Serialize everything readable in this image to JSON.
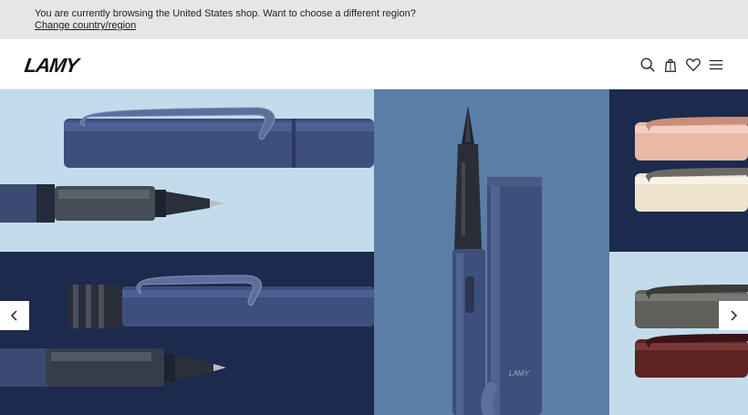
{
  "region_banner": {
    "message": "You are currently browsing the United States shop. Want to choose a different region?",
    "link": "Change country/region"
  },
  "header": {
    "logo": "LAMY",
    "icons": [
      "search-icon",
      "shopping-bag-icon",
      "heart-icon",
      "menu-icon"
    ]
  },
  "hero": {
    "controls": [
      "chevron-left-icon",
      "chevron-right-icon"
    ]
  },
  "colors": {
    "banner_bg": "#e6e6e6",
    "light_blue": "#c3dcec",
    "navy": "#1c2a4d",
    "mid_blue": "#5a7ea5",
    "pen_blue": "#3d4f7c"
  }
}
